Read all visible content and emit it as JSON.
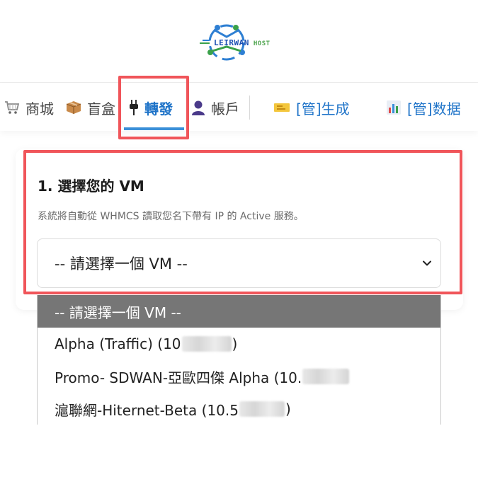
{
  "logo": {
    "main_text": "LEIRWAN",
    "sub_text": "HOST"
  },
  "nav": {
    "items": [
      {
        "icon": "shopping-cart-icon",
        "label": "商城"
      },
      {
        "icon": "package-icon",
        "label": "盲盒"
      },
      {
        "icon": "plug-icon",
        "label": "轉發"
      },
      {
        "icon": "user-icon",
        "label": "帳戶"
      },
      {
        "icon": "ticket-icon",
        "label": "[管]生成"
      },
      {
        "icon": "bar-chart-icon",
        "label": "[管]数据"
      }
    ],
    "active_index": 2
  },
  "step": {
    "title": "1. 選擇您的 VM",
    "description": "系統將自動從 WHMCS 讀取您名下帶有 IP 的 Active 服務。"
  },
  "vm_select": {
    "value": "-- 請選擇一個 VM --",
    "options": [
      {
        "prefix": "-- 請選擇一個 VM --",
        "suffix": ""
      },
      {
        "prefix": "Alpha (Traffic) (10",
        "suffix": ")"
      },
      {
        "prefix": "Promo- SDWAN-亞歐四傑 Alpha (10.",
        "suffix": ""
      },
      {
        "prefix": "滬聯網-Hiternet-Beta (10.5",
        "suffix": ")"
      }
    ]
  },
  "colors": {
    "accent": "#1e73c8",
    "highlight": "#f0555a",
    "selected_option_bg": "#767676"
  }
}
